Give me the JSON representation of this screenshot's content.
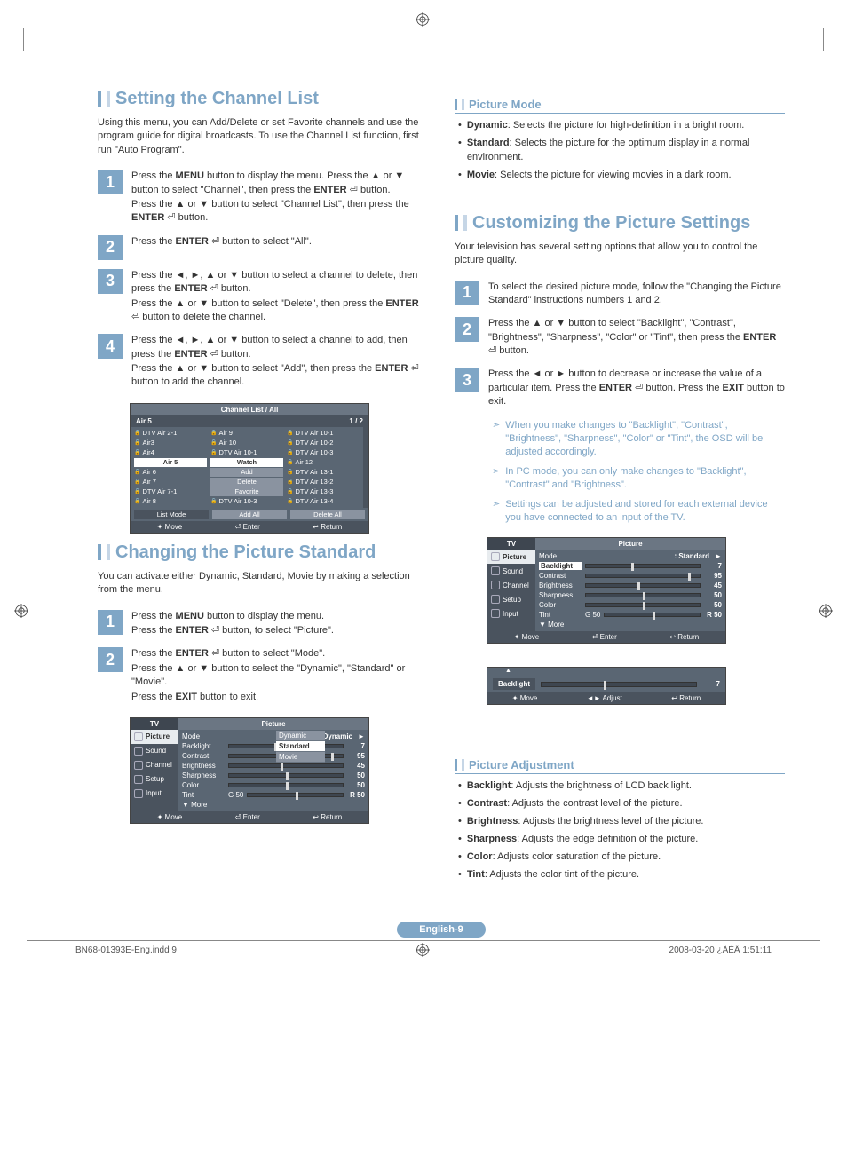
{
  "page_number_label": "English-9",
  "footer": {
    "left": "BN68-01393E-Eng.indd   9",
    "right": "2008-03-20   ¿ÀÈÄ 1:51:11"
  },
  "left_col": {
    "section1": {
      "title": "Setting the Channel List",
      "intro": "Using this menu, you can Add/Delete or set Favorite channels and use the program guide for digital broadcasts. To use the Channel List function, first run \"Auto Program\".",
      "steps": [
        {
          "n": "1",
          "lines": [
            "Press the <b>MENU</b> button to display the menu. Press the ▲ or ▼ button to select \"Channel\", then press the <b>ENTER</b> ⏎ button.",
            "Press the ▲ or ▼ button to select \"Channel List\", then press the <b>ENTER</b> ⏎ button."
          ]
        },
        {
          "n": "2",
          "lines": [
            "Press the <b>ENTER</b> ⏎ button to select \"All\"."
          ]
        },
        {
          "n": "3",
          "lines": [
            "Press the ◄, ►, ▲ or ▼ button to select a channel to delete, then press the <b>ENTER</b> ⏎ button.",
            "Press the ▲ or ▼ button to select \"Delete\", then press the <b>ENTER</b> ⏎ button to delete the channel."
          ]
        },
        {
          "n": "4",
          "lines": [
            "Press the ◄, ►, ▲ or ▼ button to select a channel to add, then press the <b>ENTER</b> ⏎ button.",
            "Press the ▲ or ▼ button to select \"Add\", then press the <b>ENTER</b> ⏎ button to add the channel."
          ]
        }
      ],
      "osd": {
        "title": "Channel List / All",
        "sub_left": "Air 5",
        "sub_right": "1 / 2",
        "grid": [
          [
            "DTV Air 2-1",
            "Air 9",
            "DTV Air 10-1"
          ],
          [
            "Air3",
            "Air 10",
            "DTV Air 10-2"
          ],
          [
            "Air4",
            "DTV Air 10-1",
            "DTV Air 10-3"
          ],
          [
            "Air 5",
            "Watch",
            "Air 12"
          ],
          [
            "Air 6",
            "Add",
            "DTV Air 13-1"
          ],
          [
            "Air 7",
            "Delete",
            "DTV Air 13-2"
          ],
          [
            "DTV Air 7-1",
            "Favorite",
            "DTV Air 13-3"
          ],
          [
            "Air 8",
            "DTV Air 10-3",
            "DTV Air 13-4"
          ]
        ],
        "sel_row": 3,
        "btn_rows": [
          3,
          4,
          5,
          6
        ],
        "legend": [
          "List Mode",
          "Add All",
          "Delete All"
        ],
        "foot": [
          "✦ Move",
          "⏎ Enter",
          "↩ Return"
        ]
      }
    },
    "section2": {
      "title": "Changing the Picture Standard",
      "intro": "You can activate either Dynamic, Standard, Movie by making a selection from the menu.",
      "steps": [
        {
          "n": "1",
          "lines": [
            "Press the <b>MENU</b> button to display the menu.",
            "Press the <b>ENTER</b> ⏎ button, to select \"Picture\"."
          ]
        },
        {
          "n": "2",
          "lines": [
            "Press the <b>ENTER</b> ⏎ button to select \"Mode\".",
            "Press the ▲ or ▼ button to select the \"Dynamic\", \"Standard\" or \"Movie\".",
            "Press the <b>EXIT</b> button to exit."
          ]
        }
      ],
      "osd": {
        "tv": "TV",
        "caption": "Picture",
        "side": [
          "Picture",
          "Sound",
          "Channel",
          "Setup",
          "Input"
        ],
        "rows": [
          {
            "lbl": "Mode",
            "type": "dd",
            "val": ": Dynamic",
            "popup": [
              "Dynamic",
              "Standard",
              "Movie"
            ],
            "popup_sel": 1
          },
          {
            "lbl": "Backlight",
            "type": "slider",
            "num": "7",
            "pos": 40
          },
          {
            "lbl": "Contrast",
            "type": "slider",
            "num": "95",
            "pos": 90
          },
          {
            "lbl": "Brightness",
            "type": "slider",
            "num": "45",
            "pos": 45
          },
          {
            "lbl": "Sharpness",
            "type": "slider",
            "num": "50",
            "pos": 50
          },
          {
            "lbl": "Color",
            "type": "slider",
            "num": "50",
            "pos": 50
          },
          {
            "lbl": "Tint",
            "type": "slider",
            "left": "G 50",
            "num": "R 50",
            "pos": 50
          },
          {
            "lbl": "▼ More",
            "type": "more"
          }
        ],
        "foot": [
          "✦ Move",
          "⏎ Enter",
          "↩ Return"
        ]
      }
    }
  },
  "right_col": {
    "sub1": {
      "title": "Picture Mode",
      "bullets": [
        {
          "b": "Dynamic",
          "t": ": Selects the picture for high-definition in a bright room."
        },
        {
          "b": "Standard",
          "t": ": Selects the picture for the optimum display in a normal environment."
        },
        {
          "b": "Movie",
          "t": ": Selects the picture for viewing movies in a dark room."
        }
      ]
    },
    "section3": {
      "title": "Customizing the Picture Settings",
      "intro": "Your television has several setting options that allow you to control the picture quality.",
      "steps": [
        {
          "n": "1",
          "lines": [
            "To select the desired picture mode, follow the \"Changing the Picture Standard\" instructions numbers 1 and 2."
          ]
        },
        {
          "n": "2",
          "lines": [
            "Press the ▲ or ▼ button to select \"Backlight\", \"Contrast\", \"Brightness\", \"Sharpness\", \"Color\" or \"Tint\", then press the <b>ENTER</b> ⏎ button."
          ]
        },
        {
          "n": "3",
          "lines": [
            "Press the ◄ or ► button to decrease or increase the value of a particular item. Press the <b>ENTER</b> ⏎ button. Press the <b>EXIT</b> button to exit."
          ]
        }
      ],
      "notes": [
        "When you make changes to \"Backlight\", \"Contrast\", \"Brightness\", \"Sharpness\", \"Color\" or \"Tint\", the OSD will be adjusted accordingly.",
        "In PC mode, you can only make changes to \"Backlight\", \"Contrast\" and \"Brightness\".",
        "Settings can be adjusted and stored for each external device you have connected to an input of the TV."
      ],
      "osd": {
        "tv": "TV",
        "caption": "Picture",
        "side": [
          "Picture",
          "Sound",
          "Channel",
          "Setup",
          "Input"
        ],
        "rows": [
          {
            "lbl": "Mode",
            "type": "val",
            "val": ": Standard"
          },
          {
            "lbl": "Backlight",
            "type": "slider",
            "num": "7",
            "pos": 40,
            "sel": true
          },
          {
            "lbl": "Contrast",
            "type": "slider",
            "num": "95",
            "pos": 90
          },
          {
            "lbl": "Brightness",
            "type": "slider",
            "num": "45",
            "pos": 45
          },
          {
            "lbl": "Sharpness",
            "type": "slider",
            "num": "50",
            "pos": 50
          },
          {
            "lbl": "Color",
            "type": "slider",
            "num": "50",
            "pos": 50
          },
          {
            "lbl": "Tint",
            "type": "slider",
            "left": "G 50",
            "num": "R 50",
            "pos": 50
          },
          {
            "lbl": "▼ More",
            "type": "more"
          }
        ],
        "foot": [
          "✦ Move",
          "⏎ Enter",
          "↩ Return"
        ]
      },
      "osd_bar": {
        "tri": "▲",
        "label": "Backlight",
        "num": "7",
        "foot": [
          "✦ Move",
          "◄► Adjust",
          "↩ Return"
        ]
      }
    },
    "sub2": {
      "title": "Picture Adjustment",
      "bullets": [
        {
          "b": "Backlight",
          "t": ": Adjusts the brightness of LCD back light."
        },
        {
          "b": "Contrast",
          "t": ": Adjusts the contrast level of the picture."
        },
        {
          "b": "Brightness",
          "t": ": Adjusts the brightness level of the picture."
        },
        {
          "b": "Sharpness",
          "t": ": Adjusts the edge definition of the picture."
        },
        {
          "b": "Color",
          "t": ": Adjusts color saturation of the picture."
        },
        {
          "b": "Tint",
          "t": ": Adjusts the color tint of the picture."
        }
      ]
    }
  }
}
